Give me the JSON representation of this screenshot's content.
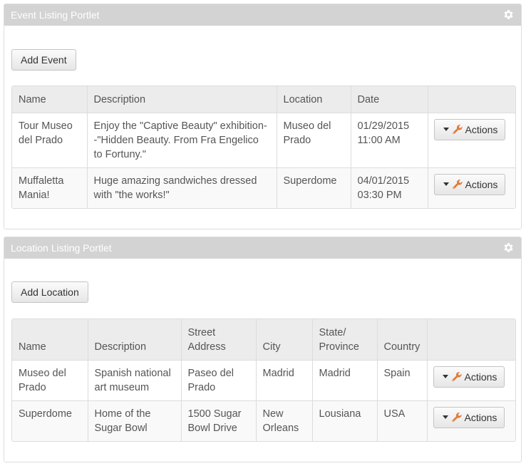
{
  "event_portlet": {
    "title": "Event Listing Portlet",
    "add_label": "Add Event",
    "columns": [
      "Name",
      "Description",
      "Location",
      "Date",
      ""
    ],
    "rows": [
      {
        "name": "Tour Museo del Prado",
        "description": "Enjoy the \"Captive Beauty\" exhibition--\"Hidden Beauty. From Fra Engelico to Fortuny.\"",
        "location": "Museo del Prado",
        "date": "01/29/2015 11:00 AM",
        "actions_label": "Actions"
      },
      {
        "name": "Muffaletta Mania!",
        "description": "Huge amazing sandwiches dressed with \"the works!\"",
        "location": "Superdome",
        "date": "04/01/2015 03:30 PM",
        "actions_label": "Actions"
      }
    ]
  },
  "location_portlet": {
    "title": "Location Listing Portlet",
    "add_label": "Add Location",
    "columns": [
      "Name",
      "Description",
      "Street Address",
      "City",
      "State/ Province",
      "Country",
      ""
    ],
    "rows": [
      {
        "name": "Museo del Prado",
        "description": "Spanish national art museum",
        "street": "Paseo del Prado",
        "city": "Madrid",
        "state": "Madrid",
        "country": "Spain",
        "actions_label": "Actions"
      },
      {
        "name": "Superdome",
        "description": "Home of the Sugar Bowl",
        "street": "1500 Sugar Bowl Drive",
        "city": "New Orleans",
        "state": "Lousiana",
        "country": "USA",
        "actions_label": "Actions"
      }
    ]
  },
  "icons": {
    "header": "gear-icon",
    "actions": "wrench-icon"
  },
  "colors": {
    "header_bg": "#d3d3d3",
    "header_text": "#ffffff",
    "wrench": "#e07b39"
  }
}
